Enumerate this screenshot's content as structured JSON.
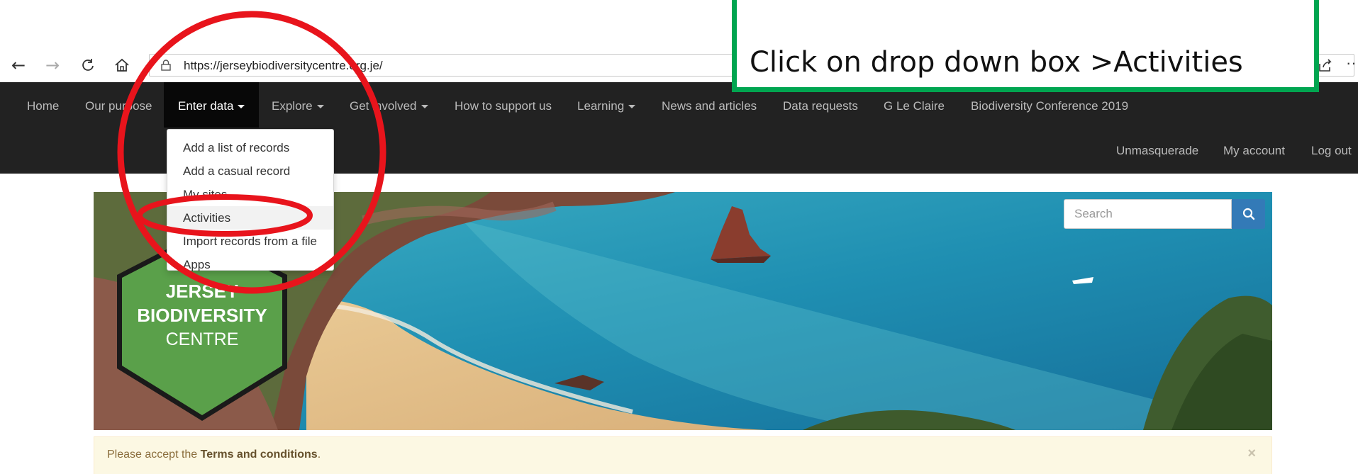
{
  "browser": {
    "url": "https://jerseybiodiversitycentre.org.je/",
    "icons": [
      "back-arrow-icon",
      "forward-arrow-icon",
      "refresh-icon",
      "home-icon",
      "lock-icon",
      "share-icon",
      "more-icon"
    ]
  },
  "navbar": {
    "items": [
      {
        "label": "Home",
        "dropdown": false
      },
      {
        "label": "Our purpose",
        "dropdown": false
      },
      {
        "label": "Enter data",
        "dropdown": true
      },
      {
        "label": "Explore",
        "dropdown": true
      },
      {
        "label": "Get involved",
        "dropdown": true
      },
      {
        "label": "How to support us",
        "dropdown": false
      },
      {
        "label": "Learning",
        "dropdown": true
      },
      {
        "label": "News and articles",
        "dropdown": false
      },
      {
        "label": "Data requests",
        "dropdown": false
      },
      {
        "label": "G Le Claire",
        "dropdown": false
      },
      {
        "label": "Biodiversity Conference 2019",
        "dropdown": false
      }
    ],
    "right_items": [
      {
        "label": "Unmasquerade"
      },
      {
        "label": "My account"
      },
      {
        "label": "Log out"
      }
    ]
  },
  "dropdown": {
    "items": [
      {
        "label": "Add a list of records"
      },
      {
        "label": "Add a casual record"
      },
      {
        "label": "My sites"
      },
      {
        "label": "Activities"
      },
      {
        "label": "Import records from a file"
      },
      {
        "label": "Apps"
      }
    ]
  },
  "search": {
    "placeholder": "Search"
  },
  "logo": {
    "line1": "JERSEY",
    "line2": "BIODIVERSITY",
    "line3": "CENTRE",
    "color": "#5aa04a"
  },
  "alert": {
    "prefix": "Please accept the ",
    "link": "Terms and conditions",
    "suffix": ".",
    "close": "×"
  },
  "annotation": {
    "callout_text": "Click on drop down box  >Activities",
    "callout_color": "#00a550",
    "circle_color": "#e8141c"
  }
}
